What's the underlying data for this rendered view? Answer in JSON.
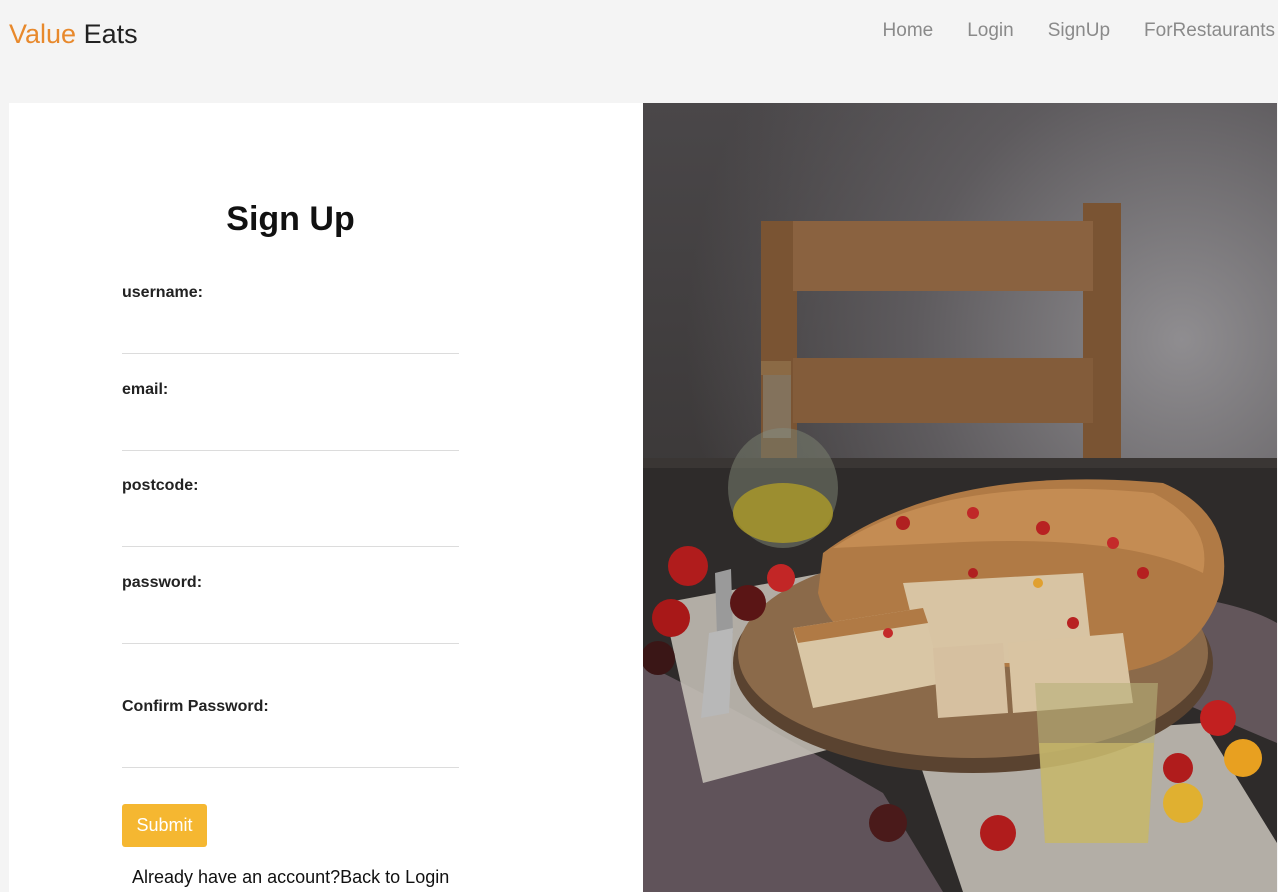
{
  "brand": {
    "accent": "Value",
    "rest": " Eats"
  },
  "nav": {
    "items": [
      {
        "label": "Home"
      },
      {
        "label": "Login"
      },
      {
        "label": "SignUp"
      },
      {
        "label": "ForRestaurants"
      }
    ]
  },
  "form": {
    "title": "Sign Up",
    "fields": [
      {
        "label": "username:",
        "value": ""
      },
      {
        "label": "email:",
        "value": ""
      },
      {
        "label": "postcode:",
        "value": ""
      },
      {
        "label": "password:",
        "value": ""
      },
      {
        "label": "Confirm Password:",
        "value": ""
      }
    ],
    "submit_label": "Submit",
    "already_text": "Already have an account?",
    "back_link": "Back to Login"
  },
  "hero_image": {
    "subject": "focaccia bread with tomatoes on wooden board, olive oil jar, chair"
  },
  "colors": {
    "accent": "#e8892c",
    "button": "#f5b731",
    "nav_text": "#8a8a8a"
  }
}
